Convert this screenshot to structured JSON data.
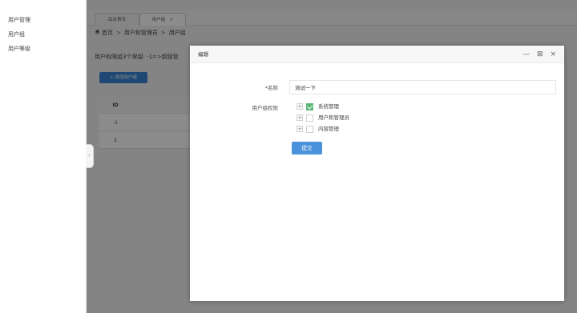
{
  "sidebar": {
    "items": [
      {
        "label": "用户管理"
      },
      {
        "label": "用户组"
      },
      {
        "label": "用户等级"
      }
    ]
  },
  "tabs": [
    {
      "label": "后台首页",
      "active": false
    },
    {
      "label": "用户组",
      "active": true,
      "close": "×"
    }
  ],
  "breadcrumb": {
    "home_icon": "home-icon",
    "items": [
      "首页",
      "用户和管理员",
      "用户组"
    ],
    "separator": ">"
  },
  "page": {
    "notice": "用户权限组3个保留: -1=>超级管",
    "add_button": "+ 添加用户组",
    "table": {
      "header_id": "ID",
      "rows": [
        {
          "id": "-1"
        },
        {
          "id": "2"
        }
      ]
    }
  },
  "collapse_handle": "‹",
  "modal": {
    "title": "编辑",
    "controls": {
      "minimize": "—",
      "maximize": "⊠",
      "close": "×"
    },
    "form": {
      "name_label": "*名称",
      "name_value": "测试一下",
      "perm_label": "用户组权限",
      "permissions": [
        {
          "label": "系统管理",
          "checked": true
        },
        {
          "label": "用户和管理员",
          "checked": false
        },
        {
          "label": "内容管理",
          "checked": false
        }
      ],
      "expander": "+",
      "submit": "提交"
    }
  },
  "colors": {
    "overlay": "rgba(0,0,0,0.45)",
    "primary": "#4a92db",
    "checked": "#5fb878"
  }
}
